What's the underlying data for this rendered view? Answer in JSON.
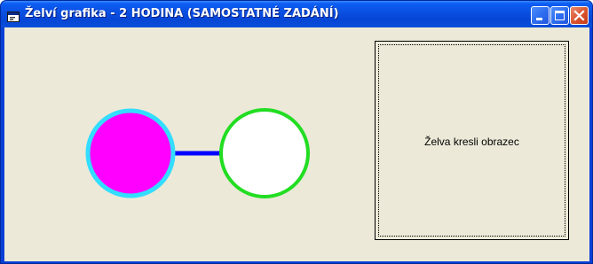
{
  "window": {
    "title": "Želví grafika - 2 HODINA (SAMOSTATNÉ ZADÁNÍ)",
    "icon": "app-form-icon",
    "controls": [
      "minimize-icon",
      "maximize-icon",
      "close-icon"
    ]
  },
  "drawing": {
    "left_circle": {
      "fill": "#ff00ff",
      "outline": "#33ddff"
    },
    "connector": {
      "color": "#0000ff"
    },
    "right_circle": {
      "fill": "#ffffff",
      "outline": "#22dd22"
    }
  },
  "panel": {
    "label": "Želva kresli obrazec"
  },
  "colors": {
    "titlebar": "#0a4fe0",
    "client_background": "#ece9d8"
  }
}
